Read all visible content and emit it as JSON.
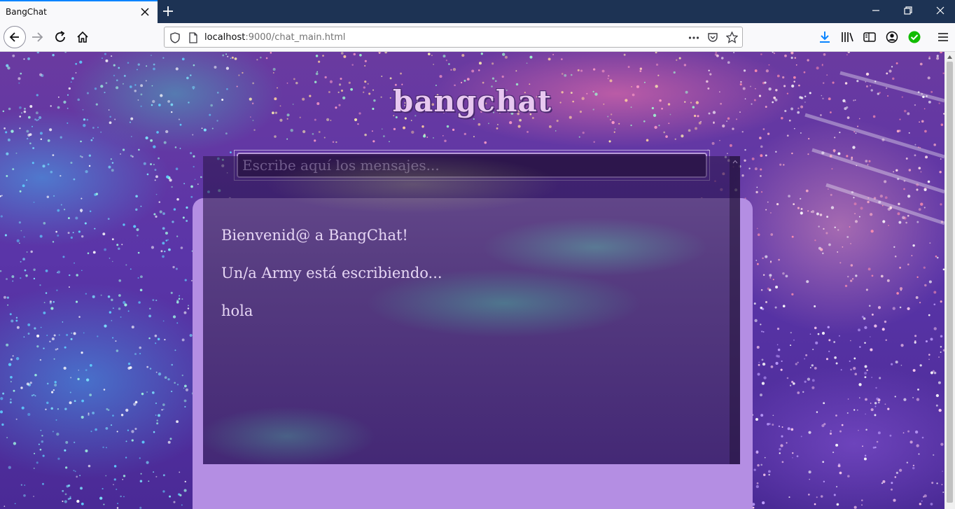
{
  "browser": {
    "tab_title": "BangChat",
    "url_host": "localhost",
    "url_rest": ":9000/chat_main.html"
  },
  "app": {
    "title": "bangchat",
    "input_placeholder": "Escribe aquí los mensajes...",
    "messages": [
      "Bienvenid@ a BangChat!",
      "Un/a Army está escribiendo...",
      "hola"
    ]
  },
  "colors": {
    "accent": "#b48ee3",
    "download": "#0a84ff",
    "status_ok": "#12bc00"
  }
}
